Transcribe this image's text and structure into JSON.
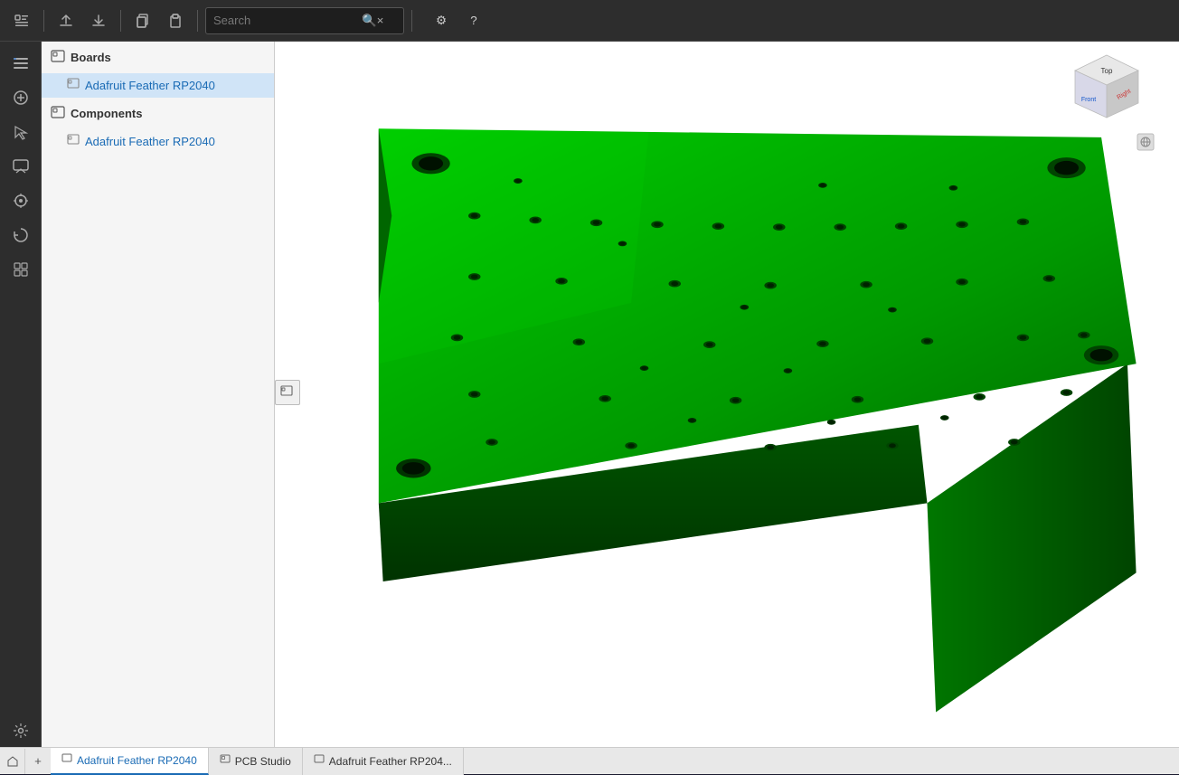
{
  "toolbar": {
    "search_placeholder": "Search",
    "buttons": [
      "menu-icon",
      "upload-icon",
      "download-icon",
      "copy-icon",
      "paste-icon"
    ],
    "search_label": "Search",
    "clear_label": "×",
    "settings_label": "⚙",
    "help_label": "?"
  },
  "left_sidebar": {
    "icons": [
      {
        "name": "layers-icon",
        "symbol": "☰"
      },
      {
        "name": "add-point-icon",
        "symbol": "+"
      },
      {
        "name": "move-icon",
        "symbol": "↖"
      },
      {
        "name": "chat-icon",
        "symbol": "💬"
      },
      {
        "name": "target-icon",
        "symbol": "◎"
      },
      {
        "name": "history-icon",
        "symbol": "↺"
      },
      {
        "name": "grid-icon",
        "symbol": "⊞"
      },
      {
        "name": "settings-bottom-icon",
        "symbol": "⚙"
      }
    ]
  },
  "panel": {
    "boards_label": "Boards",
    "board_item_label": "Adafruit Feather RP2040",
    "components_label": "Components",
    "component_item_label": "Adafruit Feather RP2040"
  },
  "viewport": {
    "board_color": "#00aa00",
    "board_highlight": "#00cc00",
    "board_shadow": "#006600"
  },
  "nav_cube": {
    "top_label": "Top",
    "front_label": "Front",
    "right_label": "Right"
  },
  "bottom_tabs": {
    "add_label": "+",
    "tabs": [
      {
        "label": "Adafruit Feather RP2040",
        "active": true,
        "icon": "board-icon"
      },
      {
        "label": "PCB Studio",
        "active": false,
        "icon": "pcb-icon"
      },
      {
        "label": "Adafruit Feather RP204...",
        "active": false,
        "icon": "board-icon"
      }
    ]
  },
  "right_panel": {
    "icons": [
      {
        "name": "properties-icon",
        "symbol": "≡"
      },
      {
        "name": "inspector-icon",
        "symbol": "≡"
      }
    ]
  }
}
